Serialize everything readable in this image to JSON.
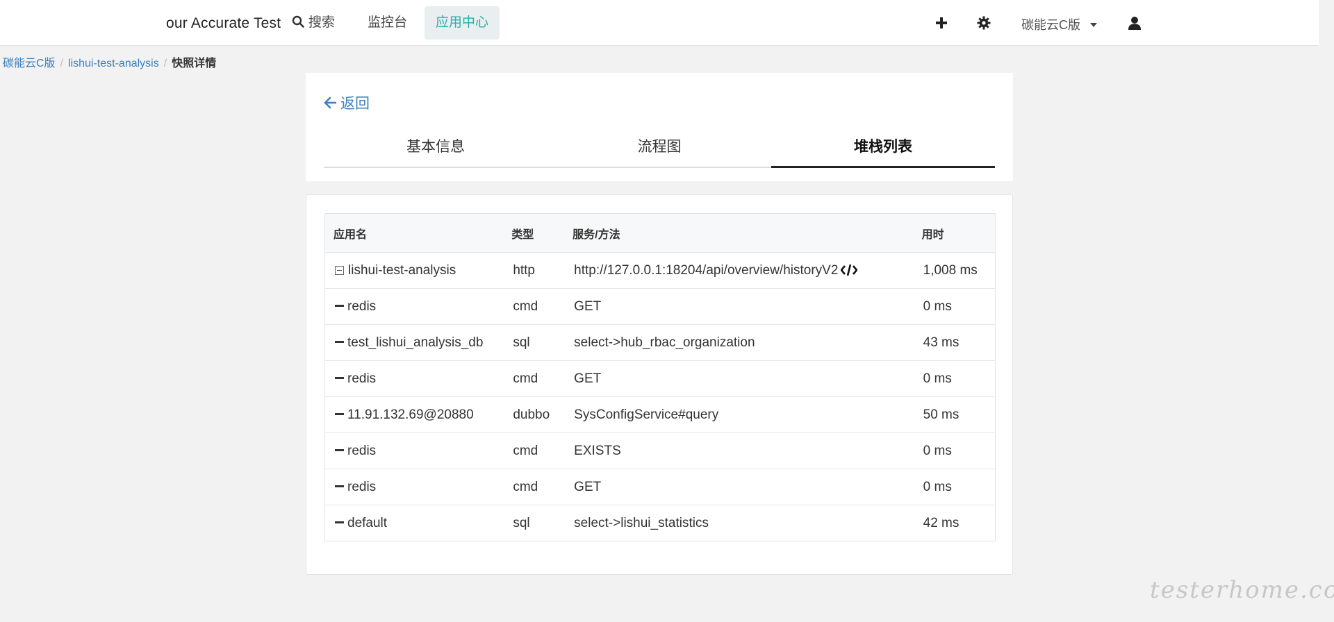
{
  "navbar": {
    "brand": "our Accurate Test",
    "search_label": "搜索",
    "monitor_label": "监控台",
    "app_center_label": "应用中心",
    "org_label": "碳能云C版"
  },
  "breadcrumb": {
    "item1": "碳能云C版",
    "item2": "lishui-test-analysis",
    "current": "快照详情"
  },
  "detail": {
    "back_label": "返回",
    "tabs": [
      "基本信息",
      "流程图",
      "堆栈列表"
    ],
    "active_tab": "堆栈列表"
  },
  "table": {
    "headers": {
      "app": "应用名",
      "type": "类型",
      "service": "服务/方法",
      "time": "用时"
    },
    "rows": [
      {
        "app": "lishui-test-analysis",
        "type": "http",
        "service": "http://127.0.0.1:18204/api/overview/historyV2",
        "time": "1,008 ms"
      },
      {
        "app": "redis",
        "type": "cmd",
        "service": "GET",
        "time": "0 ms"
      },
      {
        "app": "test_lishui_analysis_db",
        "type": "sql",
        "service": "select->hub_rbac_organization",
        "time": "43 ms"
      },
      {
        "app": "redis",
        "type": "cmd",
        "service": "GET",
        "time": "0 ms"
      },
      {
        "app": "11.91.132.69@20880",
        "type": "dubbo",
        "service": "SysConfigService#query",
        "time": "50 ms"
      },
      {
        "app": "redis",
        "type": "cmd",
        "service": "EXISTS",
        "time": "0 ms"
      },
      {
        "app": "redis",
        "type": "cmd",
        "service": "GET",
        "time": "0 ms"
      },
      {
        "app": "default",
        "type": "sql",
        "service": "select->lishui_statistics",
        "time": "42 ms"
      }
    ]
  },
  "watermark": "testerhome.com",
  "colors": {
    "accent": "#2bb0a8",
    "link": "#3c7fc0"
  }
}
